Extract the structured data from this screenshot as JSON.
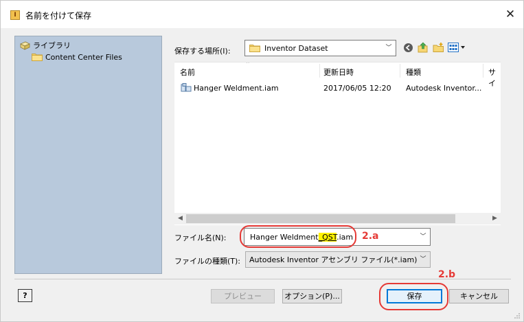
{
  "window": {
    "title": "名前を付けて保存",
    "app_icon": "inventor-app-icon",
    "close_glyph": "✕"
  },
  "places": {
    "items": [
      {
        "label": "ライブラリ",
        "icon": "library-icon"
      },
      {
        "label": "Content Center Files",
        "icon": "folder-icon"
      }
    ]
  },
  "save_in": {
    "label": "保存する場所(I):",
    "value": "Inventor Dataset"
  },
  "toolbar": {
    "icons": [
      "back-icon",
      "up-folder-icon",
      "new-folder-icon",
      "view-menu-icon"
    ]
  },
  "file_list": {
    "columns": [
      "名前",
      "更新日時",
      "種類",
      "サイ"
    ],
    "rows": [
      {
        "name": "Hanger Weldment.iam",
        "modified": "2017/06/05 12:20",
        "type": "Autodesk Inventor..."
      }
    ]
  },
  "file_name": {
    "label": "ファイル名(N):",
    "value_prefix": "Hanger Weldment",
    "value_highlight": "_QST",
    "value_suffix": ".iam"
  },
  "file_type": {
    "label": "ファイルの種類(T):",
    "value": "Autodesk Inventor アセンブリ ファイル(*.iam)"
  },
  "annotations": {
    "step_a": "2.a",
    "step_b": "2.b",
    "color": "#e53935"
  },
  "buttons": {
    "help": "?",
    "preview": "プレビュー",
    "options": "オプション(P)...",
    "save": "保存",
    "cancel": "キャンセル"
  },
  "colors": {
    "places_bg": "#b8c9dc",
    "highlight": "#fff200",
    "default_button_border": "#0078d7"
  }
}
